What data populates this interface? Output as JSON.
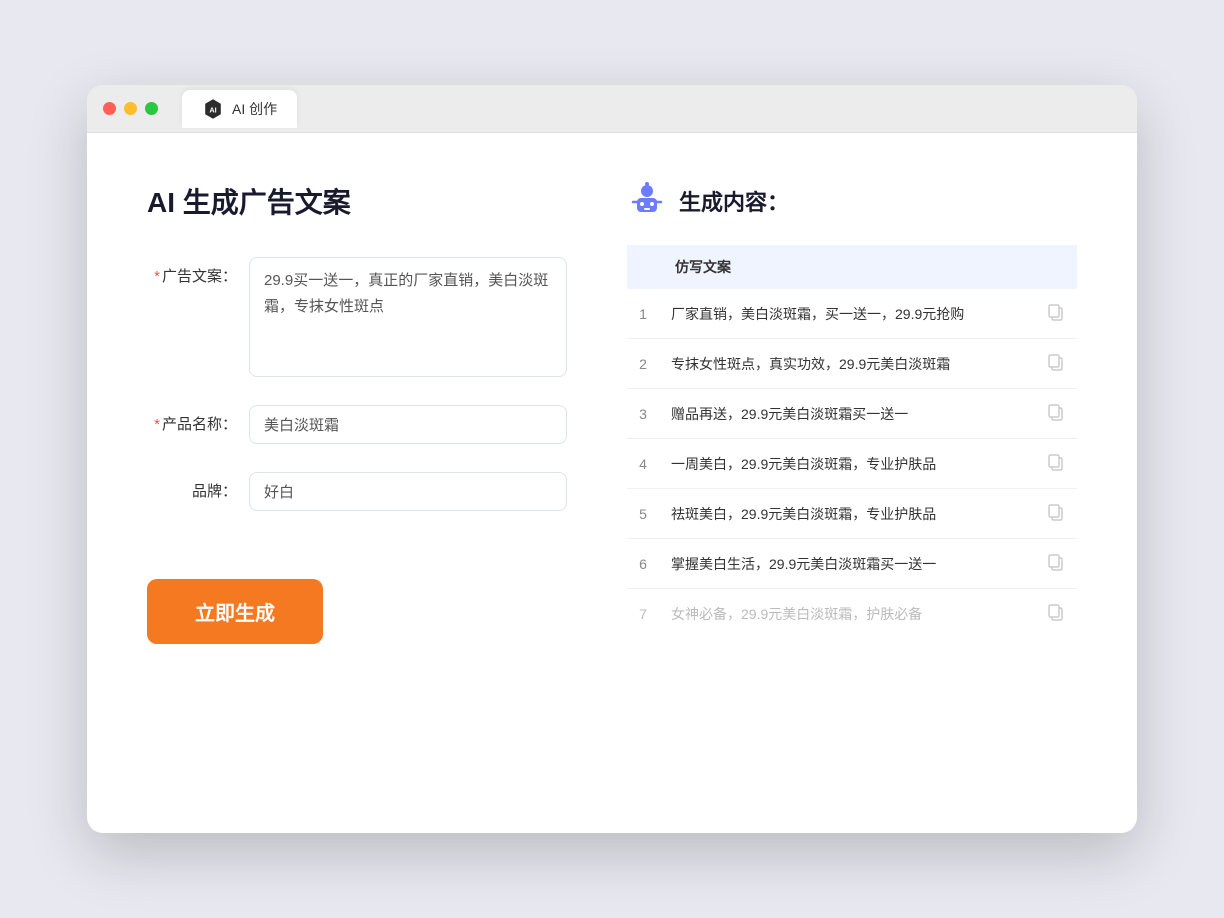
{
  "browser": {
    "tab_label": "AI 创作",
    "traffic_lights": [
      "close",
      "minimize",
      "maximize"
    ]
  },
  "page": {
    "title": "AI 生成广告文案",
    "form": {
      "ad_copy_label": "广告文案：",
      "ad_copy_required": true,
      "ad_copy_value": "29.9买一送一，真正的厂家直销，美白淡斑霜，专抹女性斑点",
      "product_name_label": "产品名称：",
      "product_name_required": true,
      "product_name_value": "美白淡斑霜",
      "brand_label": "品牌：",
      "brand_required": false,
      "brand_value": "好白",
      "generate_btn_label": "立即生成"
    },
    "result": {
      "title": "生成内容：",
      "column_label": "仿写文案",
      "items": [
        {
          "num": "1",
          "text": "厂家直销，美白淡斑霜，买一送一，29.9元抢购",
          "faded": false
        },
        {
          "num": "2",
          "text": "专抹女性斑点，真实功效，29.9元美白淡斑霜",
          "faded": false
        },
        {
          "num": "3",
          "text": "赠品再送，29.9元美白淡斑霜买一送一",
          "faded": false
        },
        {
          "num": "4",
          "text": "一周美白，29.9元美白淡斑霜，专业护肤品",
          "faded": false
        },
        {
          "num": "5",
          "text": "祛斑美白，29.9元美白淡斑霜，专业护肤品",
          "faded": false
        },
        {
          "num": "6",
          "text": "掌握美白生活，29.9元美白淡斑霜买一送一",
          "faded": false
        },
        {
          "num": "7",
          "text": "女神必备，29.9元美白淡斑霜，护肤必备",
          "faded": true
        }
      ]
    }
  }
}
